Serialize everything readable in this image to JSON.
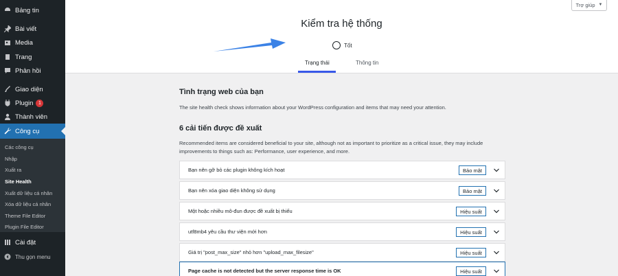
{
  "sidebar": {
    "items": [
      {
        "label": "Bảng tin",
        "icon": "dashboard-icon"
      },
      {
        "label": "Bài viết",
        "icon": "pushpin-icon"
      },
      {
        "label": "Media",
        "icon": "media-icon"
      },
      {
        "label": "Trang",
        "icon": "page-icon"
      },
      {
        "label": "Phản hồi",
        "icon": "comment-icon"
      },
      {
        "label": "Giao diện",
        "icon": "brush-icon"
      },
      {
        "label": "Plugin",
        "icon": "plugin-icon",
        "badge": "1"
      },
      {
        "label": "Thành viên",
        "icon": "user-icon"
      },
      {
        "label": "Công cụ",
        "icon": "wrench-icon"
      },
      {
        "label": "Cài đặt",
        "icon": "settings-icon"
      },
      {
        "label": "Thu gọn menu",
        "icon": "collapse-icon"
      }
    ],
    "submenu": [
      "Các công cụ",
      "Nhập",
      "Xuất ra",
      "Site Health",
      "Xuất dữ liệu cá nhân",
      "Xóa dữ liệu cá nhân",
      "Theme File Editor",
      "Plugin File Editor"
    ]
  },
  "header": {
    "title": "Kiểm tra hệ thống",
    "status": "Tốt",
    "tabs": [
      "Trạng thái",
      "Thông tin"
    ],
    "help": "Trợ giúp"
  },
  "main": {
    "heading": "Tình trạng web của bạn",
    "description": "The site health check shows information about your WordPress configuration and items that may need your attention.",
    "improvements_heading": "6 cải tiến được đề xuất",
    "improvements_desc": "Recommended items are considered beneficial to your site, although not as important to prioritize as a critical issue, they may include improvements to things such as: Performance, user experience, and more.",
    "issues": [
      {
        "label": "Bạn nên gỡ bỏ các plugin không kích hoạt",
        "badge": "Bảo mật"
      },
      {
        "label": "Bạn nên xóa giao diện không sử dụng",
        "badge": "Bảo mật"
      },
      {
        "label": "Một hoặc nhiều mô-đun được đề xuất bị thiếu",
        "badge": "Hiệu suất"
      },
      {
        "label": "utf8mb4 yêu cầu thư viện mới hơn",
        "badge": "Hiệu suất"
      },
      {
        "label": "Giá trị \"post_max_size\" nhỏ hơn \"upload_max_filesize\"",
        "badge": "Hiệu suất"
      },
      {
        "label": "Page cache is not detected but the server response time is OK",
        "badge": "Hiệu suất"
      }
    ]
  },
  "colors": {
    "accent": "#2271b1",
    "sidebar": "#1d2327",
    "badge": "#d63638",
    "arrow": "#3b82e6"
  }
}
